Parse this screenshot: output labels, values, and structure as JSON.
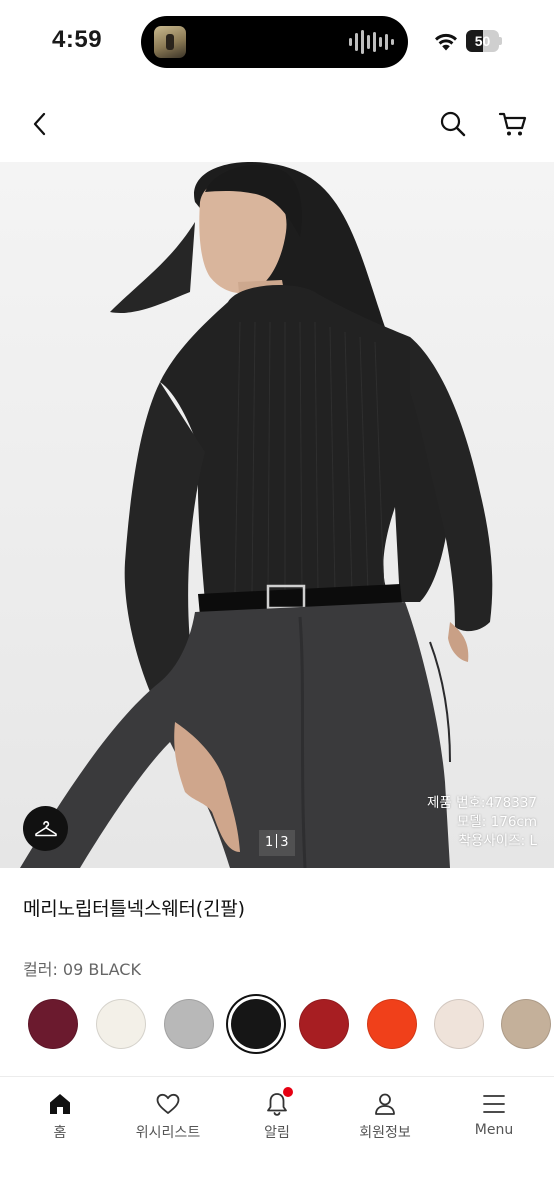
{
  "status_bar": {
    "time": "4:59",
    "battery_level": "50",
    "battery_fraction": 0.5
  },
  "header": {
    "back_icon": "chevron-left-icon",
    "search_icon": "search-icon",
    "cart_icon": "cart-icon"
  },
  "hero": {
    "product_number": "제품 번호:478337",
    "model_height": "모델: 176cm",
    "model_size": "착용사이즈: L",
    "pager_current": "1",
    "pager_total": "3",
    "hanger_icon": "hanger-icon"
  },
  "product": {
    "name": "메리노립터틀넥스웨터(긴팔)",
    "color_label": "컬러: 09 BLACK"
  },
  "swatches": [
    {
      "color": "#6b1a2e",
      "selected": false
    },
    {
      "color": "#f3f0e8",
      "selected": false
    },
    {
      "color": "#b8b8b8",
      "selected": false
    },
    {
      "color": "#161616",
      "selected": true
    },
    {
      "color": "#a71e22",
      "selected": false
    },
    {
      "color": "#f0401a",
      "selected": false
    },
    {
      "color": "#efe3da",
      "selected": false
    },
    {
      "color": "#c4b09a",
      "selected": false
    }
  ],
  "tabs": [
    {
      "label": "홈",
      "icon": "home-icon",
      "active": true
    },
    {
      "label": "위시리스트",
      "icon": "heart-icon",
      "active": false
    },
    {
      "label": "알림",
      "icon": "bell-icon",
      "active": false,
      "badge": true
    },
    {
      "label": "회원정보",
      "icon": "user-icon",
      "active": false
    },
    {
      "label": "Menu",
      "icon": "menu-icon",
      "active": false
    }
  ],
  "colors": {
    "badge": "#e60012",
    "text_primary": "#111111",
    "text_secondary": "#666666"
  }
}
